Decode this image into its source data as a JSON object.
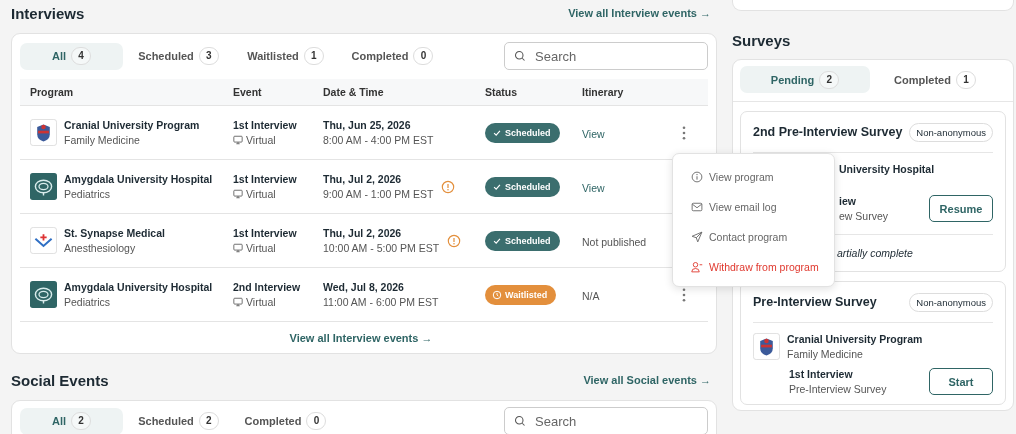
{
  "interviews": {
    "title": "Interviews",
    "view_all": "View all Interview events →",
    "tabs": [
      {
        "label": "All",
        "count": "4",
        "selected": true
      },
      {
        "label": "Scheduled",
        "count": "3",
        "selected": false
      },
      {
        "label": "Waitlisted",
        "count": "1",
        "selected": false
      },
      {
        "label": "Completed",
        "count": "0",
        "selected": false
      }
    ],
    "search": {
      "placeholder": "Search"
    },
    "columns": [
      "Program",
      "Event",
      "Date & Time",
      "Status",
      "Itinerary"
    ],
    "rows": [
      {
        "logo": {
          "kind": "shield"
        },
        "program": "Cranial University Program",
        "specialty": "Family Medicine",
        "event": "1st Interview",
        "mode": "Virtual",
        "date": "Thu, Jun 25, 2026",
        "time": "8:00 AM - 4:00 PM EST",
        "warning": false,
        "status": {
          "label": "Scheduled",
          "kind": "check",
          "color": "#3b6e6e"
        },
        "itinerary": {
          "text": "View",
          "kind": "link"
        }
      },
      {
        "logo": {
          "kind": "brain"
        },
        "program": "Amygdala University Hospital",
        "specialty": "Pediatrics",
        "event": "1st Interview",
        "mode": "Virtual",
        "date": "Thu, Jul 2, 2026",
        "time": "9:00 AM - 1:00 PM EST",
        "warning": true,
        "status": {
          "label": "Scheduled",
          "kind": "check",
          "color": "#3b6e6e"
        },
        "itinerary": {
          "text": "View",
          "kind": "link"
        }
      },
      {
        "logo": {
          "kind": "cross"
        },
        "program": "St. Synapse Medical",
        "specialty": "Anesthesiology",
        "event": "1st Interview",
        "mode": "Virtual",
        "date": "Thu, Jul 2, 2026",
        "time": "10:00 AM - 5:00 PM EST",
        "warning": true,
        "status": {
          "label": "Scheduled",
          "kind": "check",
          "color": "#3b6e6e"
        },
        "itinerary": {
          "text": "Not published",
          "kind": "text"
        }
      },
      {
        "logo": {
          "kind": "brain"
        },
        "program": "Amygdala University Hospital",
        "specialty": "Pediatrics",
        "event": "2nd Interview",
        "mode": "Virtual",
        "date": "Wed, Jul 8, 2026",
        "time": "11:00 AM - 6:00 PM EST",
        "warning": false,
        "status": {
          "label": "Waitlisted",
          "kind": "clock",
          "color": "#e38f3c"
        },
        "itinerary": {
          "text": "N/A",
          "kind": "text"
        }
      }
    ],
    "footer_link": "View all Interview events →"
  },
  "menu": {
    "items": [
      {
        "label": "View program",
        "danger": false
      },
      {
        "label": "View email log",
        "danger": false
      },
      {
        "label": "Contact program",
        "danger": false
      },
      {
        "label": "Withdraw from program",
        "danger": true
      }
    ]
  },
  "social_events": {
    "title": "Social Events",
    "view_all": "View all Social events →",
    "tabs": [
      {
        "label": "All",
        "count": "2",
        "selected": true
      },
      {
        "label": "Scheduled",
        "count": "2",
        "selected": false
      },
      {
        "label": "Completed",
        "count": "0",
        "selected": false
      }
    ],
    "search": {
      "placeholder": "Search"
    }
  },
  "surveys": {
    "title": "Surveys",
    "tabs": [
      {
        "label": "Pending",
        "count": "2",
        "selected": true
      },
      {
        "label": "Completed",
        "count": "1",
        "selected": false
      }
    ],
    "items": [
      {
        "title": "2nd Pre-Interview Survey",
        "badge": "Non-anonymous",
        "covered": true,
        "program": "University Hospital",
        "event": "iew",
        "survey": "ew Survey",
        "action": "Resume",
        "status": "artially complete"
      },
      {
        "title": "Pre-Interview Survey",
        "badge": "Non-anonymous",
        "covered": false,
        "logo": {
          "kind": "shield"
        },
        "program": "Cranial University Program",
        "specialty": "Family Medicine",
        "event": "1st Interview",
        "survey": "Pre-Interview Survey",
        "action": "Start"
      }
    ]
  }
}
